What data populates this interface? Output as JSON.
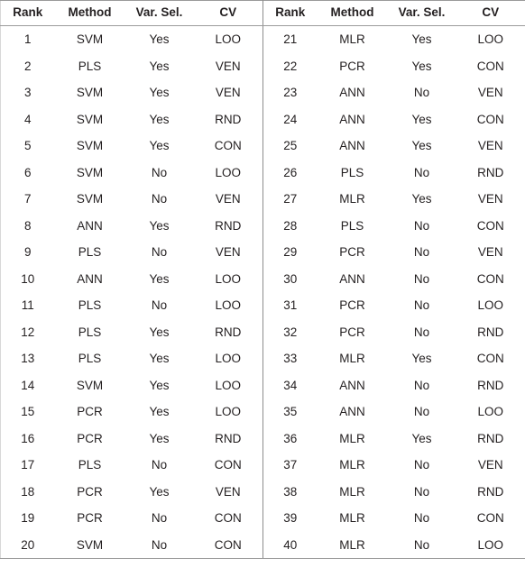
{
  "table": {
    "columns": [
      "Rank",
      "Method",
      "Var. Sel.",
      "CV"
    ],
    "left": {
      "headers": [
        "Rank",
        "Method",
        "Var. Sel.",
        "CV"
      ],
      "rows": [
        {
          "rank": "1",
          "method": "SVM",
          "var_sel": "Yes",
          "cv": "LOO"
        },
        {
          "rank": "2",
          "method": "PLS",
          "var_sel": "Yes",
          "cv": "VEN"
        },
        {
          "rank": "3",
          "method": "SVM",
          "var_sel": "Yes",
          "cv": "VEN"
        },
        {
          "rank": "4",
          "method": "SVM",
          "var_sel": "Yes",
          "cv": "RND"
        },
        {
          "rank": "5",
          "method": "SVM",
          "var_sel": "Yes",
          "cv": "CON"
        },
        {
          "rank": "6",
          "method": "SVM",
          "var_sel": "No",
          "cv": "LOO"
        },
        {
          "rank": "7",
          "method": "SVM",
          "var_sel": "No",
          "cv": "VEN"
        },
        {
          "rank": "8",
          "method": "ANN",
          "var_sel": "Yes",
          "cv": "RND"
        },
        {
          "rank": "9",
          "method": "PLS",
          "var_sel": "No",
          "cv": "VEN"
        },
        {
          "rank": "10",
          "method": "ANN",
          "var_sel": "Yes",
          "cv": "LOO"
        },
        {
          "rank": "11",
          "method": "PLS",
          "var_sel": "No",
          "cv": "LOO"
        },
        {
          "rank": "12",
          "method": "PLS",
          "var_sel": "Yes",
          "cv": "RND"
        },
        {
          "rank": "13",
          "method": "PLS",
          "var_sel": "Yes",
          "cv": "LOO"
        },
        {
          "rank": "14",
          "method": "SVM",
          "var_sel": "Yes",
          "cv": "LOO"
        },
        {
          "rank": "15",
          "method": "PCR",
          "var_sel": "Yes",
          "cv": "LOO"
        },
        {
          "rank": "16",
          "method": "PCR",
          "var_sel": "Yes",
          "cv": "RND"
        },
        {
          "rank": "17",
          "method": "PLS",
          "var_sel": "No",
          "cv": "CON"
        },
        {
          "rank": "18",
          "method": "PCR",
          "var_sel": "Yes",
          "cv": "VEN"
        },
        {
          "rank": "19",
          "method": "PCR",
          "var_sel": "No",
          "cv": "CON"
        },
        {
          "rank": "20",
          "method": "SVM",
          "var_sel": "No",
          "cv": "CON"
        }
      ]
    },
    "right": {
      "headers": [
        "Rank",
        "Method",
        "Var. Sel.",
        "CV"
      ],
      "rows": [
        {
          "rank": "21",
          "method": "MLR",
          "var_sel": "Yes",
          "cv": "LOO"
        },
        {
          "rank": "22",
          "method": "PCR",
          "var_sel": "Yes",
          "cv": "CON"
        },
        {
          "rank": "23",
          "method": "ANN",
          "var_sel": "No",
          "cv": "VEN"
        },
        {
          "rank": "24",
          "method": "ANN",
          "var_sel": "Yes",
          "cv": "CON"
        },
        {
          "rank": "25",
          "method": "ANN",
          "var_sel": "Yes",
          "cv": "VEN"
        },
        {
          "rank": "26",
          "method": "PLS",
          "var_sel": "No",
          "cv": "RND"
        },
        {
          "rank": "27",
          "method": "MLR",
          "var_sel": "Yes",
          "cv": "VEN"
        },
        {
          "rank": "28",
          "method": "PLS",
          "var_sel": "No",
          "cv": "CON"
        },
        {
          "rank": "29",
          "method": "PCR",
          "var_sel": "No",
          "cv": "VEN"
        },
        {
          "rank": "30",
          "method": "ANN",
          "var_sel": "No",
          "cv": "CON"
        },
        {
          "rank": "31",
          "method": "PCR",
          "var_sel": "No",
          "cv": "LOO"
        },
        {
          "rank": "32",
          "method": "PCR",
          "var_sel": "No",
          "cv": "RND"
        },
        {
          "rank": "33",
          "method": "MLR",
          "var_sel": "Yes",
          "cv": "CON"
        },
        {
          "rank": "34",
          "method": "ANN",
          "var_sel": "No",
          "cv": "RND"
        },
        {
          "rank": "35",
          "method": "ANN",
          "var_sel": "No",
          "cv": "LOO"
        },
        {
          "rank": "36",
          "method": "MLR",
          "var_sel": "Yes",
          "cv": "RND"
        },
        {
          "rank": "37",
          "method": "MLR",
          "var_sel": "No",
          "cv": "VEN"
        },
        {
          "rank": "38",
          "method": "MLR",
          "var_sel": "No",
          "cv": "RND"
        },
        {
          "rank": "39",
          "method": "MLR",
          "var_sel": "No",
          "cv": "CON"
        },
        {
          "rank": "40",
          "method": "MLR",
          "var_sel": "No",
          "cv": "LOO"
        }
      ]
    }
  },
  "style": {
    "text_color": "#231f20",
    "rule_color": "#9b9b9b",
    "divider_color": "#8c8c8c",
    "background": "#ffffff"
  }
}
